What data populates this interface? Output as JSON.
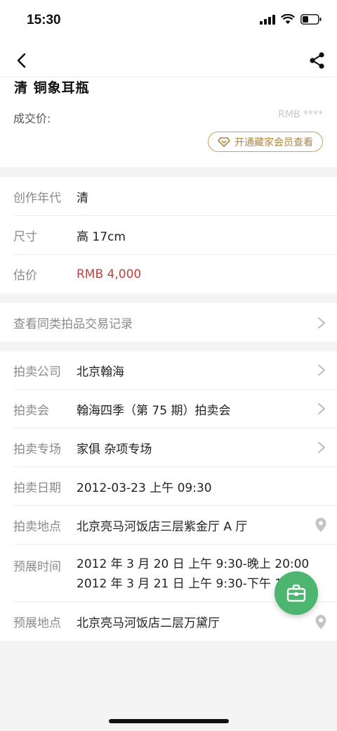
{
  "status": {
    "time": "15:30"
  },
  "lot": {
    "title": "清 铜象耳瓶",
    "price_label": "成交价:",
    "price_masked": "RMB ****",
    "member_button": "开通藏家会员查看"
  },
  "details": [
    {
      "label": "创作年代",
      "value": "清"
    },
    {
      "label": "尺寸",
      "value": "高 17cm"
    },
    {
      "label": "估价",
      "value": "RMB  4,000"
    }
  ],
  "record_link": "查看同类拍品交易记录",
  "auction": {
    "company": {
      "label": "拍卖公司",
      "value": "北京翰海"
    },
    "session": {
      "label": "拍卖会",
      "value": "翰海四季（第 75 期）拍卖会"
    },
    "special": {
      "label": "拍卖专场",
      "value": "家俱 杂项专场"
    },
    "date": {
      "label": "拍卖日期",
      "value": "2012-03-23 上午 09:30"
    },
    "venue": {
      "label": "拍卖地点",
      "value": "北京亮马河饭店三层紫金厅 A 厅"
    },
    "preview_time": {
      "label": "预展时间",
      "line1": "2012 年 3 月 20 日 上午 9:30-晚上 20:00",
      "line2": "2012 年 3 月 21 日 上午 9:30-下午 18"
    },
    "preview_venue": {
      "label": "预展地点",
      "value": "北京亮马河饭店二层万黛厅"
    }
  },
  "colors": {
    "accent_gold": "#b08640",
    "estimate_red": "#c0413a",
    "fab_green": "#4cb56f"
  },
  "icons": [
    "back-icon",
    "share-icon",
    "diamond-icon",
    "chevron-right-icon",
    "location-pin-icon",
    "briefcase-icon"
  ]
}
